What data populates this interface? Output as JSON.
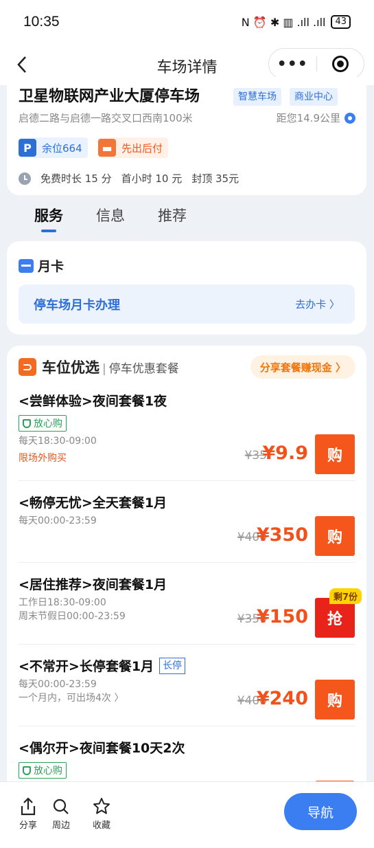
{
  "status": {
    "time": "10:35",
    "battery": "43",
    "icons_text": "N ⏰ ✱ ▥ .ıll .ıll"
  },
  "nav": {
    "title": "车场详情",
    "menu_icon": "more-dots-icon",
    "close_icon": "target-icon"
  },
  "lot": {
    "name": "卫星物联网产业大厦停车场",
    "tags": [
      "智慧车场",
      "商业中心"
    ],
    "address": "启德二路与启德一路交叉口西南100米",
    "distance": "距您14.9公里",
    "spots_icon": "P",
    "spots": "余位664",
    "pay_mode": "先出后付",
    "fee": {
      "free": "免费时长 15 分",
      "first_hour": "首小时 10 元",
      "cap": "封顶 35元"
    }
  },
  "tabs": [
    {
      "label": "服务",
      "active": true
    },
    {
      "label": "信息",
      "active": false
    },
    {
      "label": "推荐",
      "active": false
    }
  ],
  "monthly": {
    "title": "月卡",
    "row_label": "停车场月卡办理",
    "action": "去办卡 〉"
  },
  "packages": {
    "title": "车位优选",
    "subtitle": "停车优惠套餐",
    "share": "分享套餐赚现金 〉",
    "items": [
      {
        "name": "<尝鲜体验>夜间套餐1夜",
        "badge": "放心购",
        "meta": "每天18:30-09:00",
        "warn": "限场外购买",
        "old": "¥35",
        "price": "¥9.9",
        "button": "购"
      },
      {
        "name": "<畅停无忧>全天套餐1月",
        "meta": "每天00:00-23:59",
        "old": "¥400",
        "price": "¥350",
        "button": "购"
      },
      {
        "name": "<居住推荐>夜间套餐1月",
        "meta": "工作日18:30-09:00",
        "meta2": "周末节假日00:00-23:59",
        "old": "¥350",
        "price": "¥150",
        "button": "抢",
        "remain": "剩7份"
      },
      {
        "name": "<不常开>长停套餐1月",
        "tag": "长停",
        "meta": "每天00:00-23:59",
        "meta2": "一个月内，可出场4次 〉",
        "old": "¥400",
        "price": "¥240",
        "button": "购"
      },
      {
        "name": "<偶尔开>夜间套餐10天2次",
        "badge": "放心购"
      }
    ]
  },
  "bottom": {
    "share": "分享",
    "nearby": "周边",
    "favorite": "收藏",
    "navigate": "导航"
  }
}
